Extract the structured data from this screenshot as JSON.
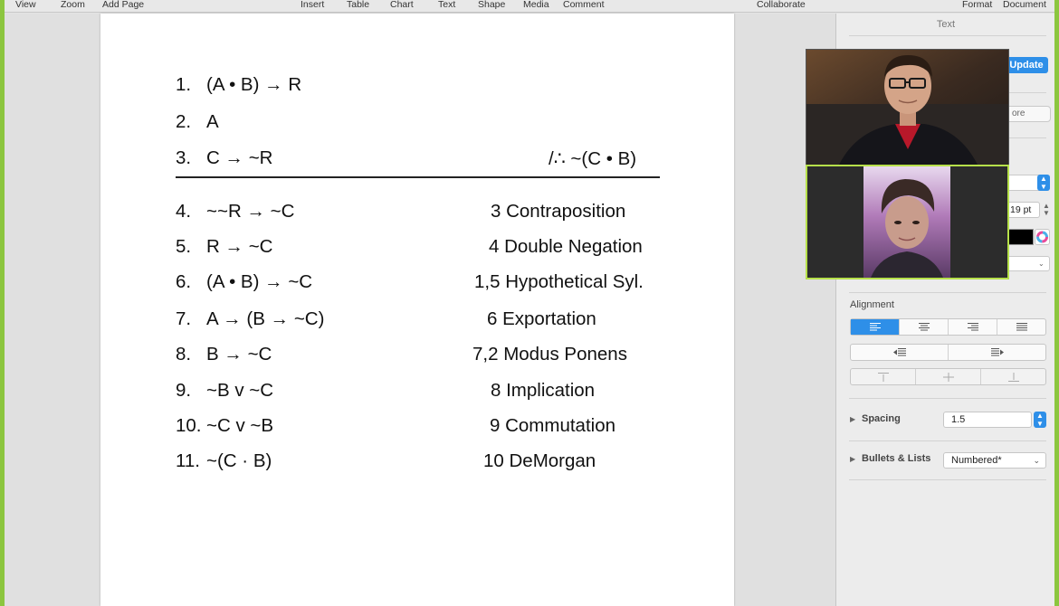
{
  "menu": {
    "view": "View",
    "zoom": "Zoom",
    "add_page": "Add Page",
    "insert": "Insert",
    "table": "Table",
    "chart": "Chart",
    "text": "Text",
    "shape": "Shape",
    "media": "Media",
    "comment": "Comment",
    "collaborate": "Collaborate",
    "format": "Format",
    "document": "Document"
  },
  "proof": {
    "premises": [
      {
        "num": "1.",
        "formula": "(A • B) → R"
      },
      {
        "num": "2.",
        "formula": "A"
      },
      {
        "num": "3.",
        "formula": "C → ~R",
        "conclusion": "/∴ ~(C • B)"
      }
    ],
    "steps": [
      {
        "num": "4.",
        "formula": "~~R → ~C",
        "justification": "3 Contraposition"
      },
      {
        "num": "5.",
        "formula": "R → ~C",
        "justification": "4 Double Negation"
      },
      {
        "num": "6.",
        "formula": "(A • B) → ~C",
        "justification": "1,5 Hypothetical Syl."
      },
      {
        "num": "7.",
        "formula": "A → (B → ~C)",
        "justification": "6 Exportation"
      },
      {
        "num": "8.",
        "formula": "B → ~C",
        "justification": "7,2 Modus Ponens"
      },
      {
        "num": "9.",
        "formula": "~B v ~C",
        "justification": "8 Implication"
      },
      {
        "num": "10.",
        "formula": "~C v ~B",
        "justification": "9 Commutation"
      },
      {
        "num": "11.",
        "formula": "~(C · B)",
        "justification": "10 DeMorgan"
      }
    ]
  },
  "inspector": {
    "title": "Text",
    "update_label": "Update",
    "more_label": "ore",
    "font_size": "19 pt",
    "text_color": "#000000",
    "alignment_label": "Alignment",
    "spacing_label": "Spacing",
    "spacing_value": "1.5",
    "bullets_label": "Bullets & Lists",
    "bullets_value": "Numbered*"
  },
  "colors": {
    "accent": "#2e8fe8",
    "frame": "#8cc63f",
    "active_speaker": "#b6e04a"
  }
}
